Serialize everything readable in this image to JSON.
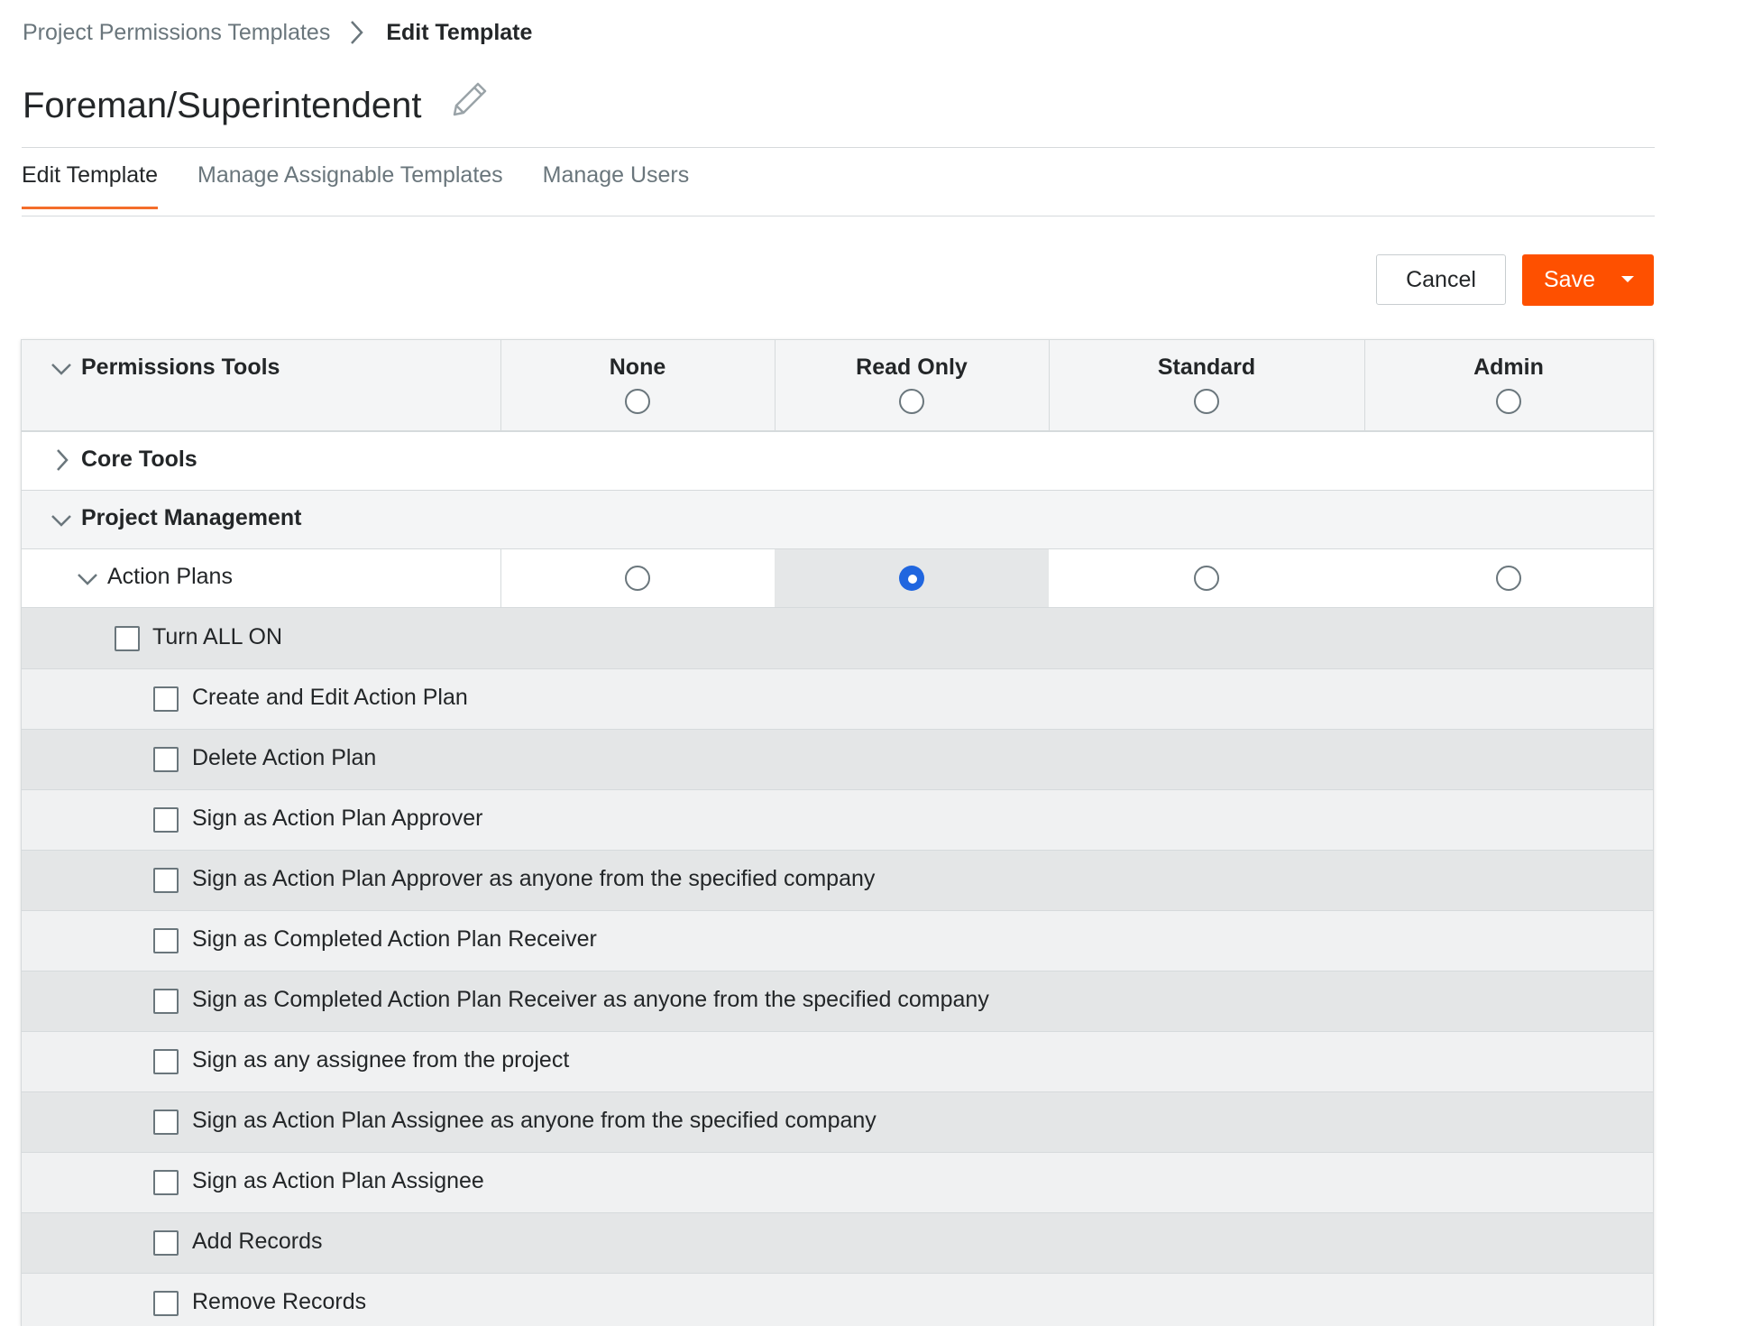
{
  "breadcrumb": {
    "parent": "Project Permissions Templates",
    "current": "Edit Template"
  },
  "page_title": "Foreman/Superintendent",
  "tabs": [
    {
      "label": "Edit Template",
      "active": true
    },
    {
      "label": "Manage Assignable Templates",
      "active": false
    },
    {
      "label": "Manage Users",
      "active": false
    }
  ],
  "actions": {
    "cancel_label": "Cancel",
    "save_label": "Save"
  },
  "colors": {
    "accent": "#fe5000",
    "tab_underline": "#f46e2b",
    "radio_selected": "#2066df"
  },
  "table": {
    "header": {
      "tools_label": "Permissions Tools",
      "levels": [
        "None",
        "Read Only",
        "Standard",
        "Admin"
      ]
    },
    "groups": {
      "core_tools": "Core Tools",
      "project_management": "Project Management"
    },
    "tool": {
      "name": "Action Plans",
      "selected_level": "Read Only"
    },
    "turn_all_on": "Turn ALL ON",
    "permissions": [
      "Create and Edit Action Plan",
      "Delete Action Plan",
      "Sign as Action Plan Approver",
      "Sign as Action Plan Approver as anyone from the specified company",
      "Sign as Completed Action Plan Receiver",
      "Sign as Completed Action Plan Receiver as anyone from the specified company",
      "Sign as any assignee from the project",
      "Sign as Action Plan Assignee as anyone from the specified company",
      "Sign as Action Plan Assignee",
      "Add Records",
      "Remove Records"
    ]
  }
}
